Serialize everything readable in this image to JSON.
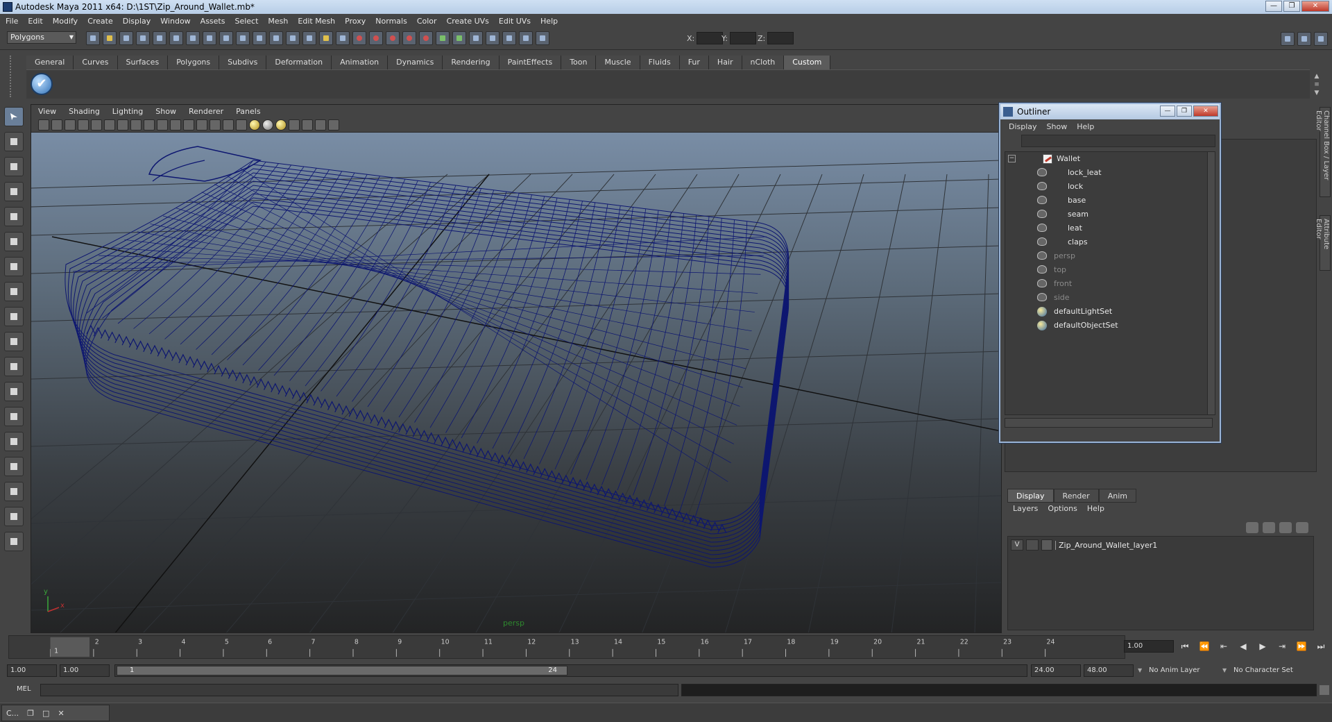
{
  "window": {
    "title": "Autodesk Maya 2011 x64: D:\\1ST\\Zip_Around_Wallet.mb*",
    "min": "—",
    "max": "❐",
    "close": "✕"
  },
  "menubar": [
    "File",
    "Edit",
    "Modify",
    "Create",
    "Display",
    "Window",
    "Assets",
    "Select",
    "Mesh",
    "Edit Mesh",
    "Proxy",
    "Normals",
    "Color",
    "Create UVs",
    "Edit UVs",
    "Help"
  ],
  "statusline": {
    "mode": "Polygons",
    "x_label": "X:",
    "y_label": "Y:",
    "z_label": "Z:"
  },
  "shelf": {
    "tabs": [
      "General",
      "Curves",
      "Surfaces",
      "Polygons",
      "Subdivs",
      "Deformation",
      "Animation",
      "Dynamics",
      "Rendering",
      "PaintEffects",
      "Toon",
      "Muscle",
      "Fluids",
      "Fur",
      "Hair",
      "nCloth",
      "Custom"
    ],
    "active_tab": "Custom",
    "icon_glyph": "✔"
  },
  "viewport": {
    "menu": [
      "View",
      "Shading",
      "Lighting",
      "Show",
      "Renderer",
      "Panels"
    ],
    "camera_label": "persp",
    "axis_x": "x",
    "axis_y": "y",
    "wire_color": "#0d1670",
    "grid_color": "#2f3338"
  },
  "outliner": {
    "title": "Outliner",
    "menu": [
      "Display",
      "Show",
      "Help"
    ],
    "expand_glyph": "−",
    "items": [
      {
        "label": "Wallet",
        "type": "group",
        "dim": false
      },
      {
        "label": "lock_leat",
        "type": "mesh",
        "dim": false
      },
      {
        "label": "lock",
        "type": "mesh",
        "dim": false
      },
      {
        "label": "base",
        "type": "mesh",
        "dim": false
      },
      {
        "label": "seam",
        "type": "mesh",
        "dim": false
      },
      {
        "label": "leat",
        "type": "mesh",
        "dim": false
      },
      {
        "label": "claps",
        "type": "mesh",
        "dim": false
      },
      {
        "label": "persp",
        "type": "camera",
        "dim": true
      },
      {
        "label": "top",
        "type": "camera",
        "dim": true
      },
      {
        "label": "front",
        "type": "camera",
        "dim": true
      },
      {
        "label": "side",
        "type": "camera",
        "dim": true
      },
      {
        "label": "defaultLightSet",
        "type": "set",
        "dim": false
      },
      {
        "label": "defaultObjectSet",
        "type": "set",
        "dim": false
      }
    ]
  },
  "side_tabs": [
    "Channel Box / Layer Editor",
    "Attribute Editor"
  ],
  "layers": {
    "tabs": [
      "Display",
      "Render",
      "Anim"
    ],
    "active_tab": "Display",
    "menu": [
      "Layers",
      "Options",
      "Help"
    ],
    "rows": [
      {
        "visible": "V",
        "name": "Zip_Around_Wallet_layer1"
      }
    ]
  },
  "timeline": {
    "ticks": [
      "1",
      "2",
      "3",
      "4",
      "5",
      "6",
      "7",
      "8",
      "9",
      "10",
      "11",
      "12",
      "13",
      "14",
      "15",
      "16",
      "17",
      "18",
      "19",
      "20",
      "21",
      "22",
      "23",
      "24"
    ],
    "current_frame": "1",
    "current_time": "1.00",
    "play_controls": [
      "⏮",
      "⏪",
      "⇤",
      "◀",
      "▶",
      "⇥",
      "⏩",
      "⏭"
    ]
  },
  "range": {
    "start": "1.00",
    "anim_start": "1.00",
    "slider_start": "1",
    "slider_end": "24",
    "end": "24.00",
    "anim_end": "48.00",
    "anim_layer": "No Anim Layer",
    "character_set": "No Character Set"
  },
  "command": {
    "label": "MEL"
  },
  "taskbar": {
    "item": "C...",
    "btn1": "❐",
    "btn2": "□",
    "btn3": "✕"
  }
}
